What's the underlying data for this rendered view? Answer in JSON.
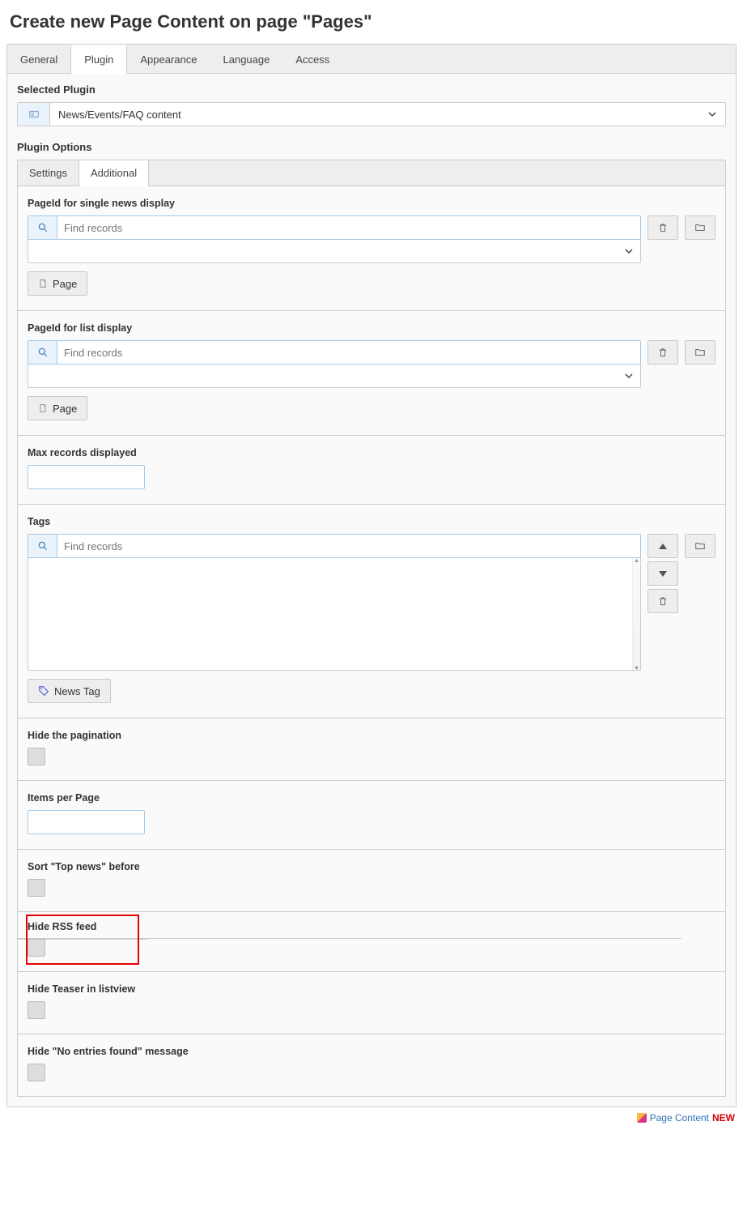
{
  "title": "Create new Page Content on page \"Pages\"",
  "top_tabs": {
    "general": "General",
    "plugin": "Plugin",
    "appearance": "Appearance",
    "language": "Language",
    "access": "Access"
  },
  "selected_plugin": {
    "label": "Selected Plugin",
    "value": "News/Events/FAQ content"
  },
  "plugin_options_label": "Plugin Options",
  "inner_tabs": {
    "settings": "Settings",
    "additional": "Additional"
  },
  "fields": {
    "single_news_pageid_label": "PageId for single news display",
    "list_pageid_label": "PageId for list display",
    "find_placeholder": "Find records",
    "page_button": "Page",
    "max_records_label": "Max records displayed",
    "tags_label": "Tags",
    "news_tag_button": "News Tag",
    "hide_pagination_label": "Hide the pagination",
    "items_per_page_label": "Items per Page",
    "sort_top_news_label": "Sort \"Top news\" before",
    "hide_rss_label": "Hide RSS feed",
    "hide_teaser_label": "Hide Teaser in listview",
    "hide_no_entries_label": "Hide \"No entries found\" message"
  },
  "footer": {
    "link": "Page Content",
    "badge": "NEW"
  }
}
